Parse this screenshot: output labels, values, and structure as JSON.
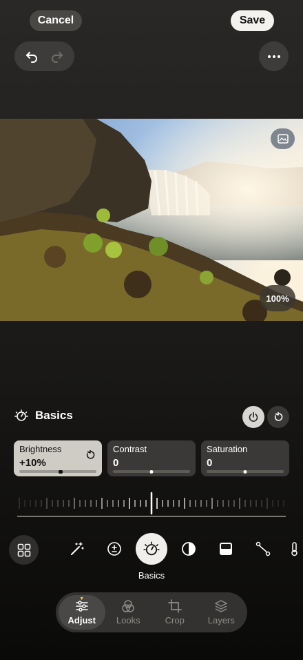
{
  "header": {
    "cancel_label": "Cancel",
    "save_label": "Save"
  },
  "toolbar": {
    "undo_icon": "undo-icon",
    "redo_icon": "redo-icon",
    "more_icon": "more-icon"
  },
  "photo": {
    "compare_icon": "compare-icon",
    "zoom_label": "100%"
  },
  "basics": {
    "title": "Basics",
    "icon": "dial-icon",
    "power_icon": "power-icon",
    "reset_icon": "reset-icon"
  },
  "adjustments": [
    {
      "label": "Brightness",
      "value": "+10%",
      "level": 0.54,
      "active": true
    },
    {
      "label": "Contrast",
      "value": "0",
      "level": 0.5,
      "active": false
    },
    {
      "label": "Saturation",
      "value": "0",
      "level": 0.5,
      "active": false
    }
  ],
  "tools": {
    "items": [
      "auto-enhance-icon",
      "exposure-icon",
      "basics-dial-icon",
      "contrast-icon",
      "split-tone-icon",
      "curves-icon",
      "temperature-icon"
    ],
    "selected": "Basics"
  },
  "tabs": [
    {
      "label": "Adjust",
      "icon": "sliders-icon",
      "active": true
    },
    {
      "label": "Looks",
      "icon": "looks-icon",
      "active": false
    },
    {
      "label": "Crop",
      "icon": "crop-icon",
      "active": false
    },
    {
      "label": "Layers",
      "icon": "layers-icon",
      "active": false
    }
  ],
  "colors": {
    "accent_dot": "#f6d02e",
    "active_card": "#cfccc6"
  }
}
